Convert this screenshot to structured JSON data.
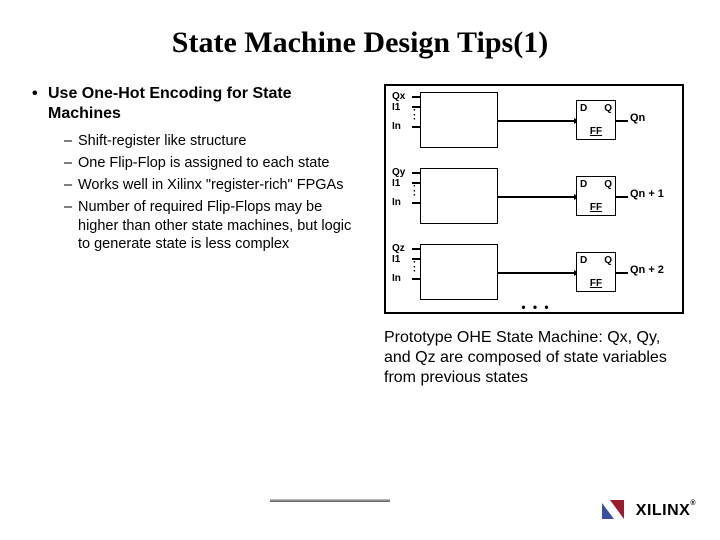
{
  "title": "State Machine Design Tips(1)",
  "bullet_main": "Use One-Hot Encoding for State Machines",
  "subs": {
    "s0": "Shift-register like structure",
    "s1": "One Flip-Flop is assigned to each state",
    "s2": "Works well in Xilinx \"register-rich\" FPGAs",
    "s3": "Number of required Flip-Flops may be higher than other state machines, but logic to generate state is less complex"
  },
  "diagram": {
    "stages": {
      "0": {
        "top": "Qx",
        "i1": "I1",
        "in": "In",
        "out": "Qn"
      },
      "1": {
        "top": "Qy",
        "i1": "I1",
        "in": "In",
        "out": "Qn + 1"
      },
      "2": {
        "top": "Qz",
        "i1": "I1",
        "in": "In",
        "out": "Qn + 2"
      }
    },
    "ff": {
      "d": "D",
      "q": "Q",
      "label": "FF"
    }
  },
  "caption": "Prototype OHE State Machine: Qx, Qy, and Qz are composed of state variables from previous states",
  "brand": "XILINX",
  "tm": "®"
}
